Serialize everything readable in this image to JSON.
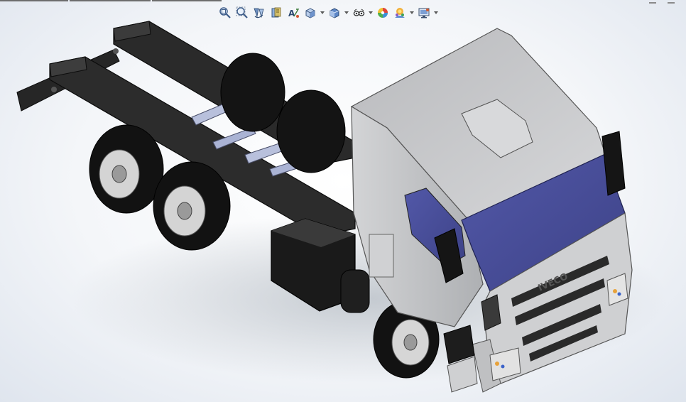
{
  "window": {
    "title": ""
  },
  "heads_up_toolbar": {
    "tools": [
      {
        "id": "zoom-to-fit",
        "icon": "zoom-to-fit-icon"
      },
      {
        "id": "zoom-to-area",
        "icon": "zoom-to-area-icon"
      },
      {
        "id": "previous-view",
        "icon": "previous-view-icon"
      },
      {
        "id": "section-view",
        "icon": "section-view-icon"
      },
      {
        "id": "dynamic-annotation-views",
        "icon": "annotation-view-icon"
      },
      {
        "id": "view-orientation",
        "icon": "view-orientation-icon",
        "dropdown": true
      },
      {
        "id": "display-style",
        "icon": "display-style-icon",
        "dropdown": true
      },
      {
        "id": "hide-show-items",
        "icon": "hide-show-icon",
        "dropdown": true
      },
      {
        "id": "edit-appearance",
        "icon": "edit-appearance-icon"
      },
      {
        "id": "apply-scene",
        "icon": "apply-scene-icon",
        "dropdown": true
      },
      {
        "id": "view-settings",
        "icon": "view-settings-icon",
        "dropdown": true
      }
    ]
  },
  "model": {
    "grille_brand_text": "IVECO",
    "colors": {
      "body": "#c9cacc",
      "body_shade": "#9c9ea1",
      "windshield": "#4b4f9a",
      "chassis": "#1e1e1e",
      "tire": "#101010",
      "rim": "#d6d6d6",
      "accent_light": "#e8a23a",
      "accent_blue": "#3b63c9"
    }
  }
}
